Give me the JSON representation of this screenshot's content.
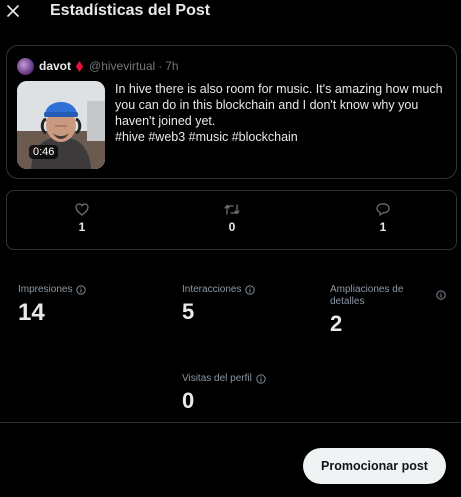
{
  "header": {
    "title": "Estadísticas del Post"
  },
  "post": {
    "author_name": "davot",
    "handle": "@hivevirtual",
    "separator": "·",
    "time": "7h",
    "video_duration": "0:46",
    "text": "In hive there is also room for music. It's amazing how much you can do in this blockchain and I don't know why you haven't joined yet.",
    "hashtags": "#hive #web3 #music #blockchain"
  },
  "engagement": {
    "likes": "1",
    "reposts": "0",
    "replies": "1"
  },
  "metrics": {
    "impressions": {
      "label": "Impresiones",
      "value": "14"
    },
    "interactions": {
      "label": "Interacciones",
      "value": "5"
    },
    "detail_expands": {
      "label": "Ampliaciones de detalles",
      "value": "2"
    },
    "profile_visits": {
      "label": "Visitas del perfil",
      "value": "0"
    }
  },
  "actions": {
    "promote_label": "Promocionar post"
  },
  "colors": {
    "background": "#000000",
    "border": "#2f3336",
    "muted": "#71767b",
    "badge": "#e31337"
  }
}
